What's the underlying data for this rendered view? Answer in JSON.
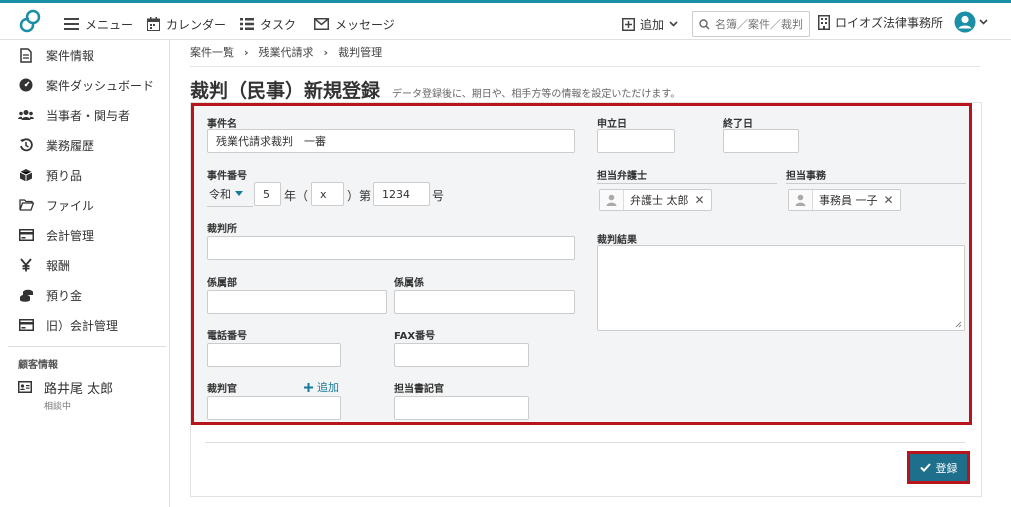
{
  "nav": {
    "menu": "メニュー",
    "calendar": "カレンダー",
    "task": "タスク",
    "message": "メッセージ",
    "add": "追加",
    "search_placeholder": "名簿／案件／裁判",
    "org": "ロイオズ法律事務所"
  },
  "sidebar": {
    "items": [
      {
        "label": "案件情報",
        "icon": "document-icon"
      },
      {
        "label": "案件ダッシュボード",
        "icon": "dashboard-icon"
      },
      {
        "label": "当事者・関与者",
        "icon": "people-icon"
      },
      {
        "label": "業務履歴",
        "icon": "history-icon"
      },
      {
        "label": "預り品",
        "icon": "box-icon"
      },
      {
        "label": "ファイル",
        "icon": "folder-icon"
      },
      {
        "label": "会計管理",
        "icon": "card-icon"
      },
      {
        "label": "報酬",
        "icon": "yen-icon"
      },
      {
        "label": "預り金",
        "icon": "coins-icon"
      },
      {
        "label": "旧）会計管理",
        "icon": "card-icon"
      }
    ],
    "customer_heading": "顧客情報",
    "customer_name": "路井尾 太郎",
    "customer_status": "相談中"
  },
  "breadcrumb": [
    "案件一覧",
    "残業代請求",
    "裁判管理"
  ],
  "page": {
    "title": "裁判（民事）新規登録",
    "subtitle": "データ登録後に、期日や、相手方等の情報を設定いただけます。"
  },
  "form": {
    "case_name_label": "事件名",
    "case_name_value": "残業代請求裁判　一審",
    "case_number_label": "事件番号",
    "era": "令和",
    "year_value": "5",
    "year_unit": "年（",
    "x_value": "x",
    "dai": "）第",
    "num_value": "1234",
    "go": "号",
    "court_label": "裁判所",
    "dept_label": "係属部",
    "section_label": "係属係",
    "phone_label": "電話番号",
    "fax_label": "FAX番号",
    "judge_label": "裁判官",
    "add_label": "追加",
    "clerk_label": "担当書記官",
    "filing_date_label": "申立日",
    "end_date_label": "終了日",
    "lawyer_label": "担当弁護士",
    "lawyer_chip": "弁護士 太郎",
    "staff_label": "担当事務",
    "staff_chip": "事務員 一子",
    "result_label": "裁判結果"
  },
  "submit_label": "登録",
  "colors": {
    "accent": "#1a8fa6",
    "button": "#1d6f8c",
    "highlight": "#b8141c",
    "form_bg": "#f3f4f6"
  }
}
